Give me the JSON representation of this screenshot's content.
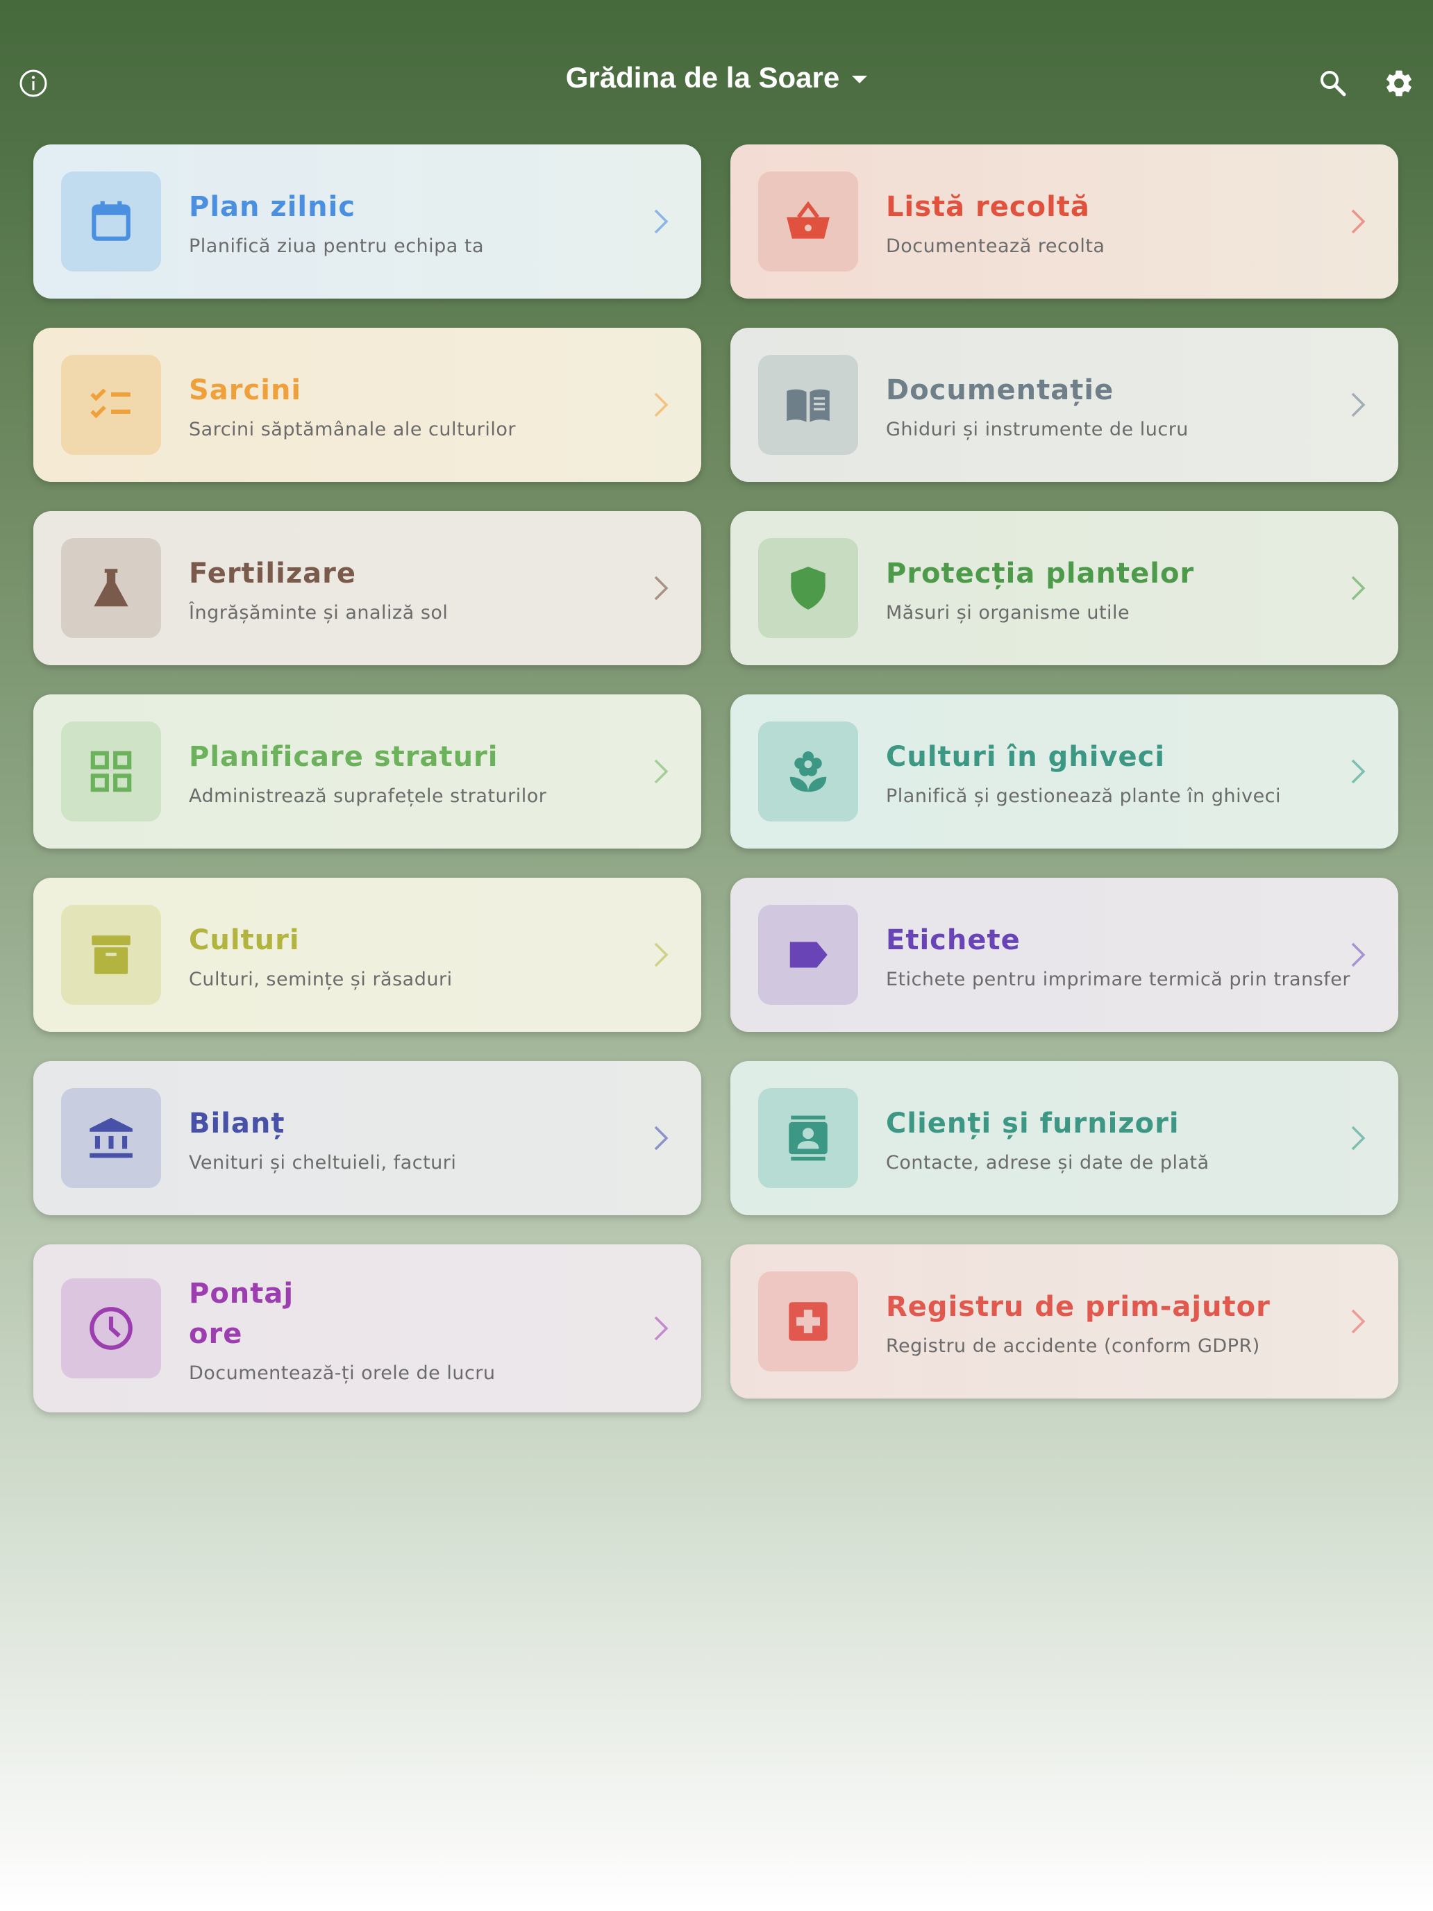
{
  "header": {
    "title": "Grădina de la Soare",
    "info_icon": "info-icon",
    "search_icon": "search-icon",
    "settings_icon": "gear-icon",
    "dropdown_icon": "caret-down-icon"
  },
  "cards": [
    {
      "title": "Plan zilnic",
      "subtitle": "Planifică ziua pentru echipa ta",
      "icon": "calendar-icon",
      "color": "#4a8fe0"
    },
    {
      "title": "Listă recoltă",
      "subtitle": "Documentează recolta",
      "icon": "basket-icon",
      "color": "#e0523e"
    },
    {
      "title": "Sarcini",
      "subtitle": "Sarcini săptămânale ale culturilor",
      "icon": "checklist-icon",
      "color": "#f0a03a"
    },
    {
      "title": "Documentație",
      "subtitle": "Ghiduri și instrumente de lucru",
      "icon": "book-icon",
      "color": "#6e7f8a"
    },
    {
      "title": "Fertilizare",
      "subtitle": "Îngrășăminte și analiză sol",
      "icon": "flask-icon",
      "color": "#7a5a4a"
    },
    {
      "title": "Protecția plantelor",
      "subtitle": "Măsuri și organisme utile",
      "icon": "shield-icon",
      "color": "#4d9a4a"
    },
    {
      "title": "Planificare straturi",
      "subtitle": "Administrează suprafețele straturilor",
      "icon": "grid-icon",
      "color": "#6cb25c"
    },
    {
      "title": "Culturi în ghiveci",
      "subtitle": "Planifică și gestionează plante în ghiveci",
      "icon": "flower-icon",
      "color": "#3c9784"
    },
    {
      "title": "Culturi",
      "subtitle": "Culturi, semințe și răsaduri",
      "icon": "archive-icon",
      "color": "#b3b33f"
    },
    {
      "title": "Etichete",
      "subtitle": "Etichete pentru imprimare termică prin transfer",
      "icon": "label-icon",
      "color": "#6844b6"
    },
    {
      "title": "Bilanț",
      "subtitle": "Venituri și cheltuieli, facturi",
      "icon": "bank-icon",
      "color": "#4751a8"
    },
    {
      "title": "Clienți și furnizori",
      "subtitle": "Contacte, adrese și date de plată",
      "icon": "contacts-icon",
      "color": "#3c9784"
    },
    {
      "title_line1": "Pontaj",
      "title_line2": "ore",
      "subtitle": "Documentează-ți orele de lucru",
      "icon": "clock-icon",
      "color": "#9c3db0"
    },
    {
      "title": "Registru de prim-ajutor",
      "subtitle": "Registru de accidente (conform GDPR)",
      "icon": "first-aid-icon",
      "color": "#e0584e"
    }
  ]
}
